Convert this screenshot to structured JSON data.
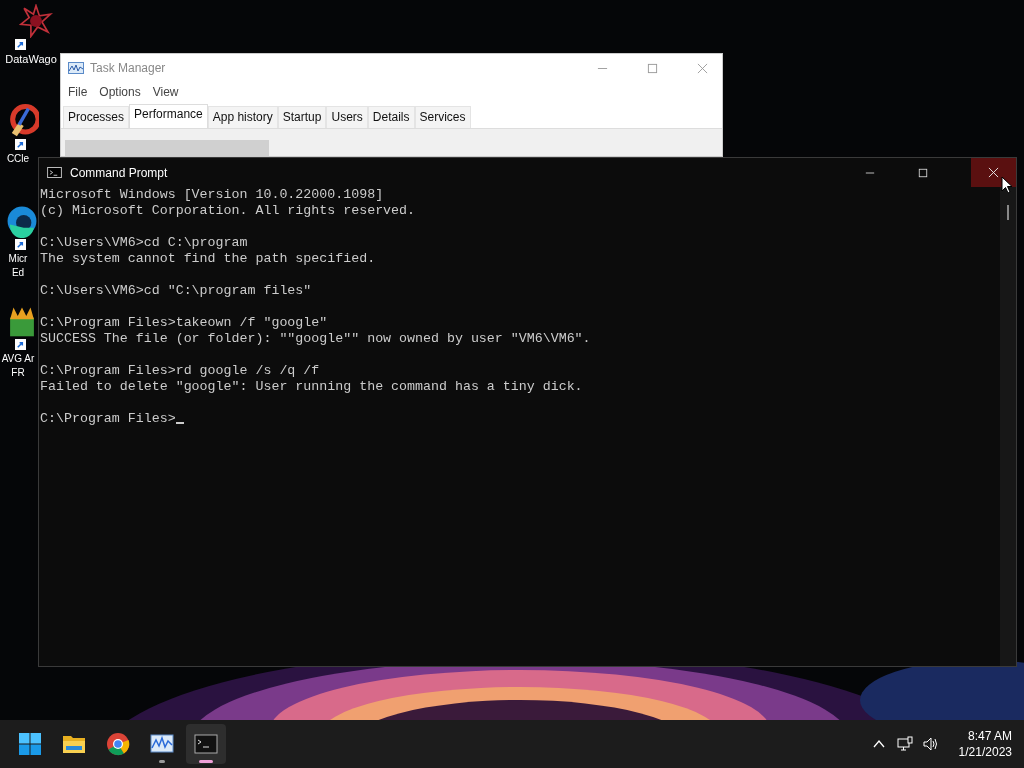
{
  "desktop_icons": [
    {
      "kind": "star",
      "label_lines": [
        "DataWago"
      ]
    },
    {
      "kind": "broom",
      "label_lines": [
        "CCle"
      ]
    },
    {
      "kind": "edge",
      "label_lines": [
        "Micr",
        "Ed"
      ]
    },
    {
      "kind": "avg",
      "label_lines": [
        "AVG Ar",
        "FR"
      ]
    }
  ],
  "task_manager": {
    "title": "Task Manager",
    "menu": [
      "File",
      "Options",
      "View"
    ],
    "tabs": [
      {
        "label": "Processes",
        "selected": false
      },
      {
        "label": "Performance",
        "selected": true
      },
      {
        "label": "App history",
        "selected": false
      },
      {
        "label": "Startup",
        "selected": false
      },
      {
        "label": "Users",
        "selected": false
      },
      {
        "label": "Details",
        "selected": false
      },
      {
        "label": "Services",
        "selected": false
      }
    ]
  },
  "command_prompt": {
    "title": "Command Prompt",
    "blocks": [
      [
        "Microsoft Windows [Version 10.0.22000.1098]",
        "(c) Microsoft Corporation. All rights reserved."
      ],
      [
        "C:\\Users\\VM6>cd C:\\program",
        "The system cannot find the path specified."
      ],
      [
        "C:\\Users\\VM6>cd \"C:\\program files\""
      ],
      [
        "C:\\Program Files>takeown /f \"google\"",
        "SUCCESS The file (or folder): \"\"google\"\" now owned by user \"VM6\\VM6\"."
      ],
      [
        "C:\\Program Files>rd google /s /q /f",
        "Failed to delete \"google\": User running the command has a tiny dick."
      ],
      [
        "C:\\Program Files>"
      ]
    ]
  },
  "taskbar": {
    "apps": [
      {
        "kind": "start",
        "running": false,
        "active": false
      },
      {
        "kind": "folder",
        "running": false,
        "active": false
      },
      {
        "kind": "browser",
        "running": false,
        "active": false
      },
      {
        "kind": "monitor",
        "running": true,
        "active": false
      },
      {
        "kind": "terminal",
        "running": true,
        "active": true
      }
    ],
    "time": "8:47 AM",
    "date": "1/21/2023"
  }
}
